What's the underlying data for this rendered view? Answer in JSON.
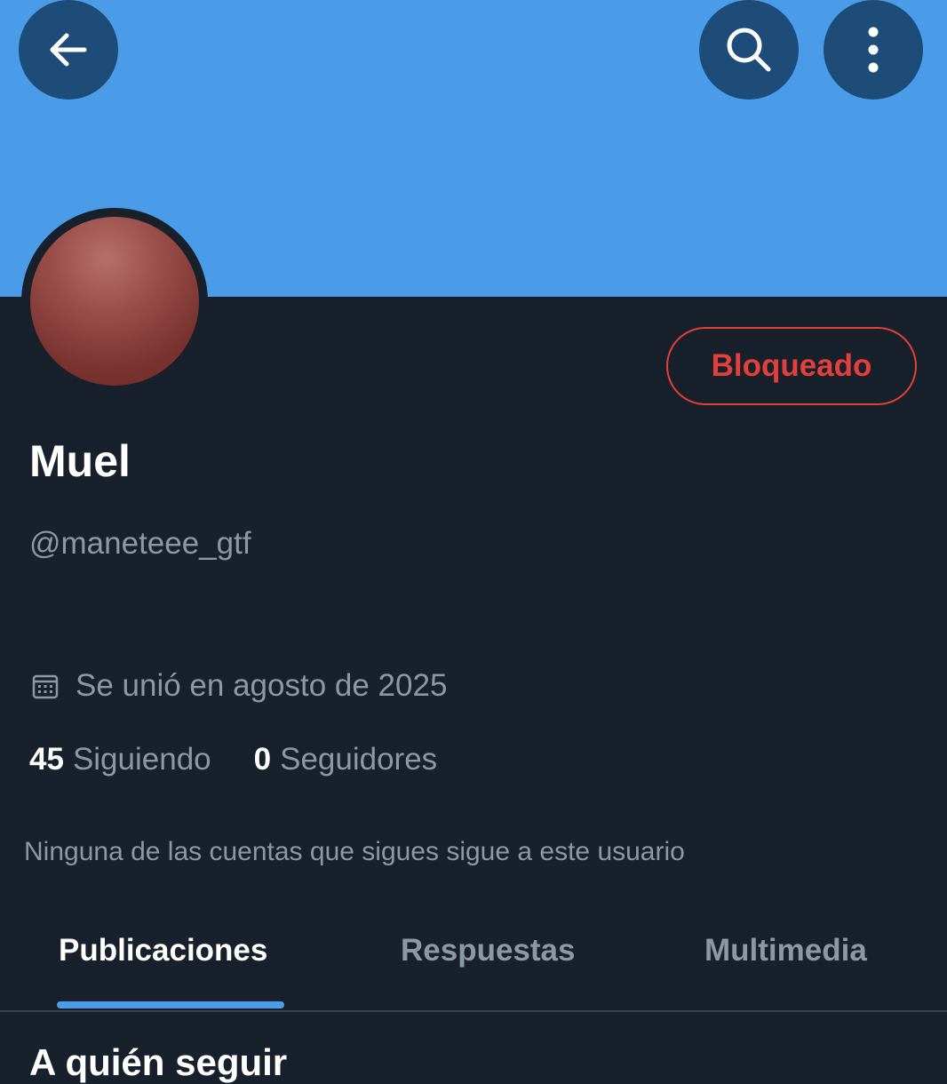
{
  "header": {
    "back_icon": "arrow-left-icon",
    "search_icon": "search-icon",
    "more_icon": "more-vertical-icon",
    "banner_color": "#4b9ce8"
  },
  "profile": {
    "name": "Muel",
    "handle": "@maneteee_gtf",
    "joined": "Se unió en agosto de 2025",
    "following_count": "45",
    "following_label": "Siguiendo",
    "followers_count": "0",
    "followers_label": "Seguidores",
    "followed_note": "Ninguna de las cuentas que sigues sigue a este usuario",
    "blocked_button": "Bloqueado",
    "blocked_color": "#e3403c"
  },
  "tabs": [
    {
      "label": "Publicaciones",
      "active": true
    },
    {
      "label": "Respuestas",
      "active": false
    },
    {
      "label": "Multimedia",
      "active": false
    }
  ],
  "section": {
    "title": "A quién seguir"
  }
}
